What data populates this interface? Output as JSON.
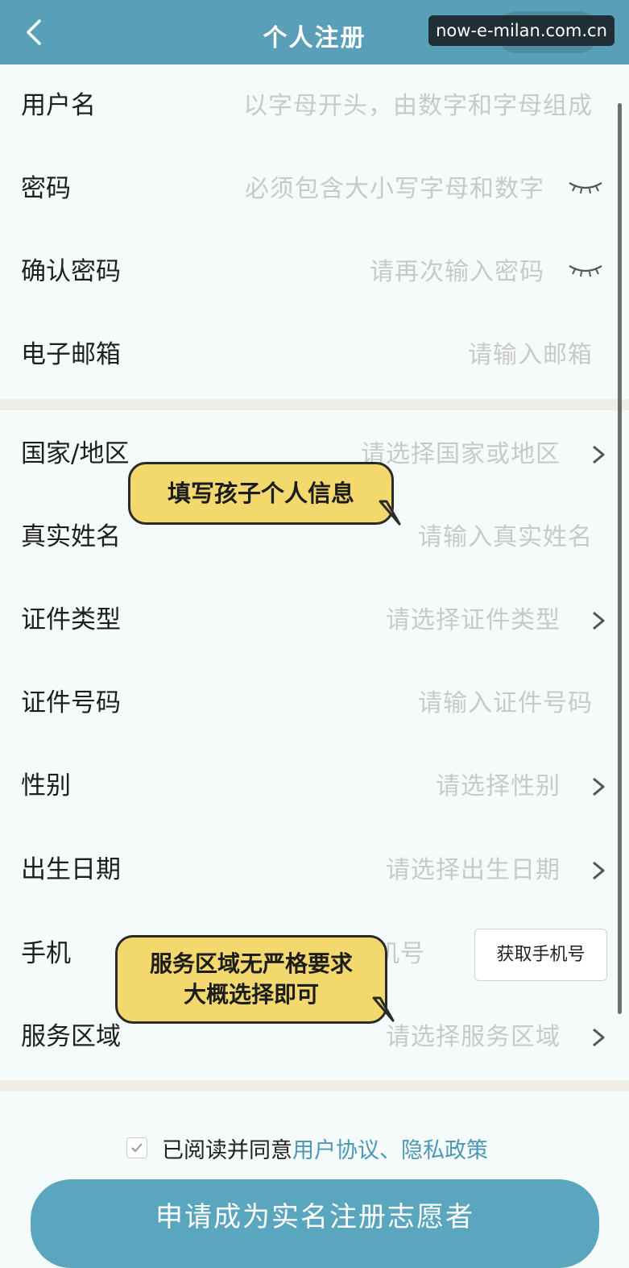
{
  "watermark": "now-e-milan.com.cn",
  "header": {
    "title": "个人注册",
    "back_icon": "chevron-left-icon"
  },
  "fields": [
    {
      "label": "用户名",
      "placeholder": "以字母开头，由数字和字母组成",
      "trailing": "none"
    },
    {
      "label": "密码",
      "placeholder": "必须包含大小写字母和数字",
      "trailing": "eye-closed-icon"
    },
    {
      "label": "确认密码",
      "placeholder": "请再次输入密码",
      "trailing": "eye-closed-icon"
    },
    {
      "label": "电子邮箱",
      "placeholder": "请输入邮箱",
      "trailing": "none"
    },
    {
      "label": "国家/地区",
      "placeholder": "请选择国家或地区",
      "trailing": "chevron-right-icon"
    },
    {
      "label": "真实姓名",
      "placeholder": "请输入真实姓名",
      "trailing": "none"
    },
    {
      "label": "证件类型",
      "placeholder": "请选择证件类型",
      "trailing": "chevron-right-icon"
    },
    {
      "label": "证件号码",
      "placeholder": "请输入证件号码",
      "trailing": "none"
    },
    {
      "label": "性别",
      "placeholder": "请选择性别",
      "trailing": "chevron-right-icon"
    },
    {
      "label": "出生日期",
      "placeholder": "请选择出生日期",
      "trailing": "chevron-right-icon"
    },
    {
      "label": "手机",
      "placeholder": "机号",
      "trailing": "button"
    },
    {
      "label": "服务区域",
      "placeholder": "请选择服务区域",
      "trailing": "chevron-right-icon"
    }
  ],
  "get_phone_button": "获取手机号",
  "callouts": {
    "personal_info": "填写孩子个人信息",
    "service_area_line1": "服务区域无严格要求",
    "service_area_line2": "大概选择即可"
  },
  "agreement": {
    "checked": true,
    "prefix": "已阅读并同意",
    "links": "用户协议、隐私政策"
  },
  "submit_button": "申请成为实名注册志愿者",
  "colors": {
    "header": "#5a9fb8",
    "accent": "#4d98b4",
    "callout": "#f3d96d",
    "placeholder": "#c9c9c9"
  }
}
